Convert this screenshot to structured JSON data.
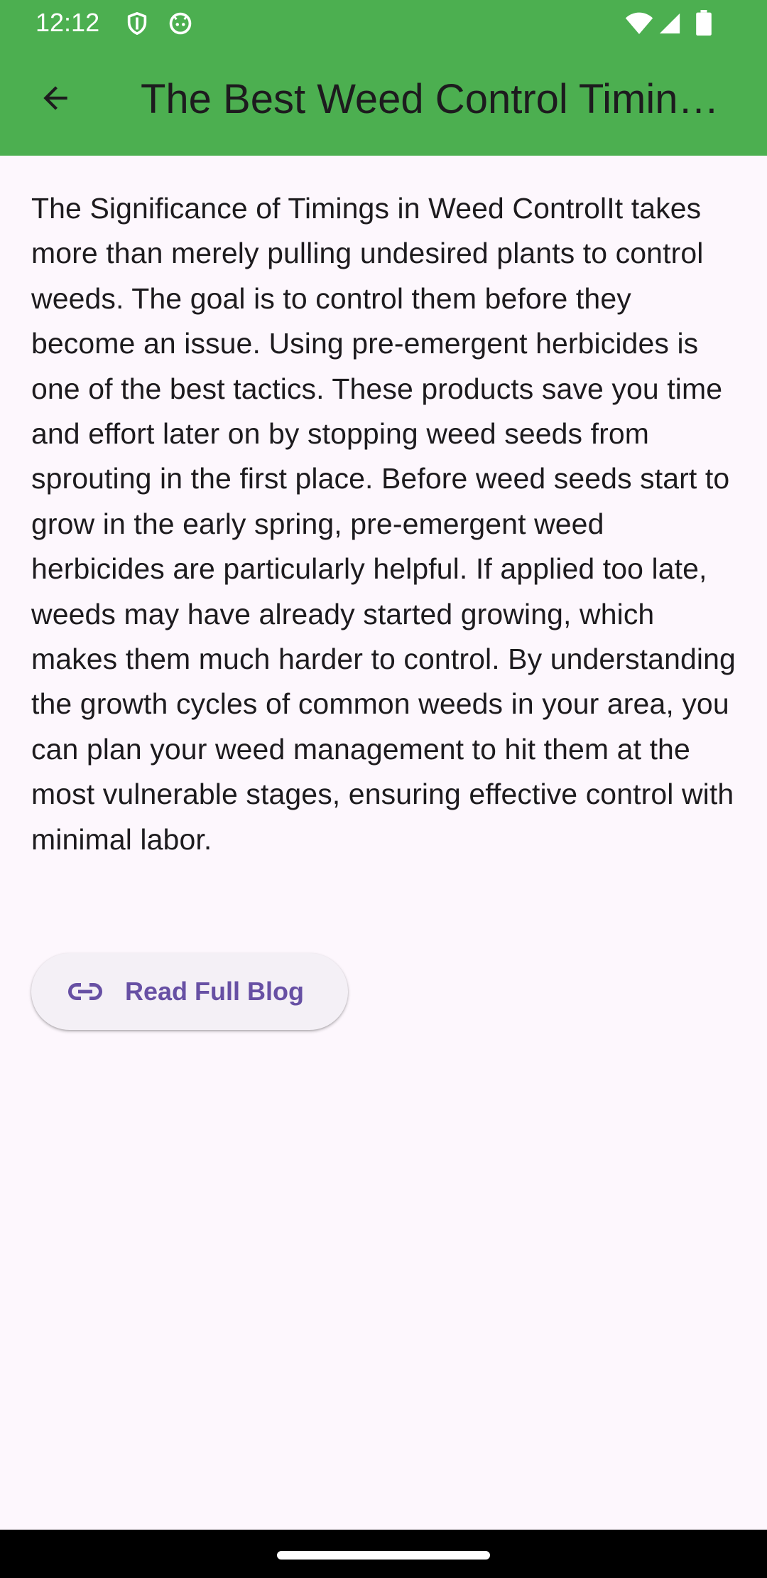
{
  "status_bar": {
    "time": "12:12",
    "icons": [
      "shield-icon",
      "android-icon",
      "wifi-icon",
      "signal-icon",
      "battery-icon"
    ]
  },
  "app_bar": {
    "title": "The Best Weed Control Timings for Every Season",
    "back_icon": "arrow-back-icon",
    "background_color": "#4CAF50"
  },
  "article": {
    "body": "The Significance of Timings in Weed ControlIt takes more than merely pulling undesired plants to control weeds. The goal is to control them before they become an issue. Using pre-emergent herbicides is one of the best tactics. These products save you time and effort later on by stopping weed seeds from sprouting in the first place. Before weed seeds start to grow in the early spring, pre-emergent weed herbicides are particularly helpful. If applied too late, weeds may have already started growing, which makes them much harder to control. By understanding the growth cycles of common weeds in your area, you can plan your weed management to hit them at the most vulnerable stages, ensuring effective control with minimal labor."
  },
  "read_button": {
    "label": "Read Full Blog",
    "icon": "link-icon",
    "accent_color": "#6750A4"
  }
}
